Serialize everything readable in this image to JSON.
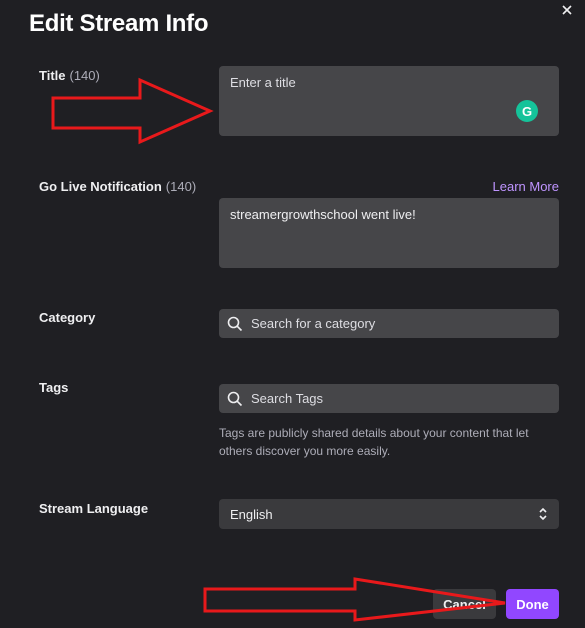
{
  "modal": {
    "title": "Edit Stream Info"
  },
  "title_field": {
    "label": "Title",
    "count": "(140)",
    "placeholder": "Enter a title",
    "grammarly_glyph": "G"
  },
  "notification_field": {
    "label": "Go Live Notification",
    "count": "(140)",
    "learn_more": "Learn More",
    "value": "streamergrowthschool went live!"
  },
  "category_field": {
    "label": "Category",
    "placeholder": "Search for a category"
  },
  "tags_field": {
    "label": "Tags",
    "placeholder": "Search Tags",
    "helper": "Tags are publicly shared details about your content that let others discover you more easily."
  },
  "language_field": {
    "label": "Stream Language",
    "value": "English"
  },
  "footer": {
    "cancel_label": "Cancel",
    "done_label": "Done"
  },
  "colors": {
    "background": "#1f1f23",
    "input": "#464649",
    "accent": "#9147ff",
    "link": "#bf94ff",
    "annotation": "#e8191b",
    "grammarly": "#15c39a"
  },
  "icons": [
    "close-icon",
    "grammarly-icon",
    "search-icon",
    "chevron-up-down-icon"
  ]
}
